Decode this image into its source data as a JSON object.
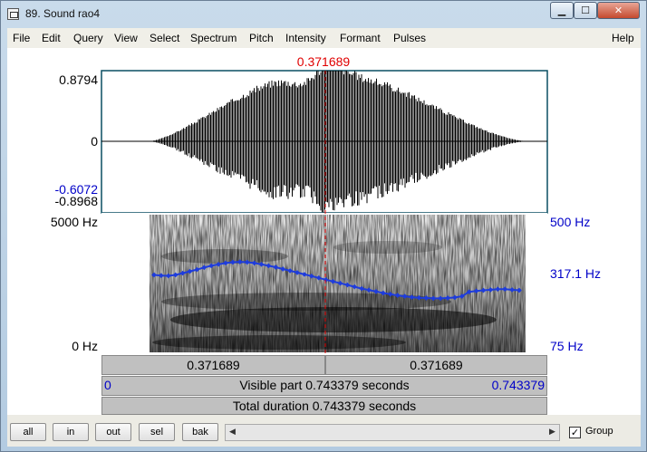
{
  "window": {
    "title": "89. Sound rao4",
    "min_glyph": "▁",
    "max_glyph": "☐",
    "close_glyph": "✕"
  },
  "menu": [
    "File",
    "Edit",
    "Query",
    "View",
    "Select",
    "Spectrum",
    "Pitch",
    "Intensity",
    "Formant",
    "Pulses"
  ],
  "menu_help": "Help",
  "cursor": {
    "time_label": "0.371689",
    "time": 0.371689
  },
  "waveform": {
    "top_label": "0.8794",
    "zero_label": "0",
    "sel_label": "-0.6072",
    "bottom_label": "-0.8968"
  },
  "spectrogram": {
    "left_top": "5000 Hz",
    "left_bottom": "0 Hz",
    "right_top": "500 Hz",
    "right_mid": "317.1 Hz",
    "right_bottom": "75 Hz"
  },
  "pitch_hz": [
    318,
    316,
    315,
    318,
    324,
    330,
    336,
    343,
    349,
    354,
    358,
    361,
    362,
    361,
    358,
    354,
    349,
    344,
    338,
    332,
    326,
    320,
    314,
    308,
    302,
    296,
    290,
    284,
    278,
    272,
    267,
    262,
    257,
    253,
    249,
    246,
    243,
    241,
    240,
    239,
    239,
    240,
    242,
    246,
    261,
    264,
    266,
    268,
    270,
    270,
    268,
    266
  ],
  "rows": {
    "left_time": "0.371689",
    "right_time": "0.371689",
    "start": "0",
    "visible": "Visible part 0.743379 seconds",
    "end": "0.743379",
    "total": "Total duration 0.743379 seconds"
  },
  "buttons": {
    "all": "all",
    "in": "in",
    "out": "out",
    "sel": "sel",
    "bak": "bak"
  },
  "scroll": {
    "left": "◀",
    "right": "▶"
  },
  "group": {
    "label": "Group",
    "checked": "✓"
  },
  "colors": {
    "cursor": "#e00000",
    "axis_blue": "#0000c8",
    "pitch": "#1e3cdc"
  }
}
